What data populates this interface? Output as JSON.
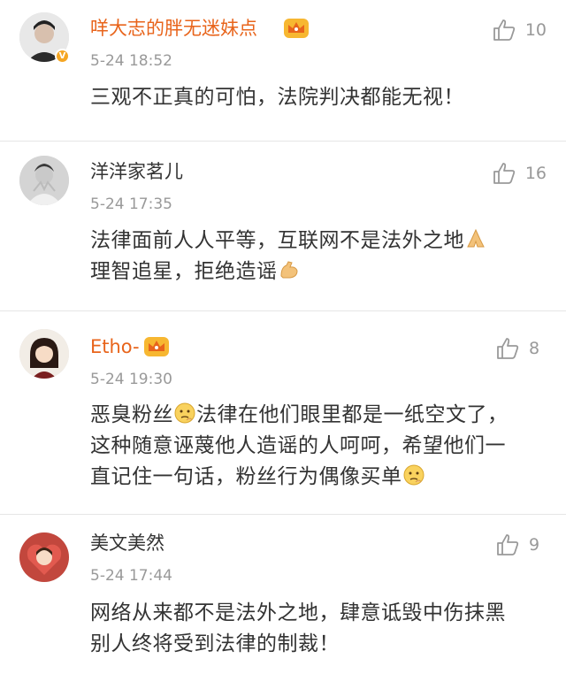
{
  "comments": [
    {
      "username": "咩大志的胖无迷妹点",
      "time": "5-24 18:52",
      "likes": "10",
      "lines": [
        "三观不正真的可怕，法院判决都能无视！"
      ]
    },
    {
      "username": "洋洋家茗儿",
      "time": "5-24 17:35",
      "likes": "16",
      "lines": [
        "法律面前人人平等，互联网不是法外之地",
        "理智追星，拒绝造谣"
      ]
    },
    {
      "username": "Etho-",
      "time": "5-24 19:30",
      "likes": "8",
      "lines": [
        "恶臭粉丝",
        "法律在他们眼里都是一纸空文了，",
        "这种随意诬蔑他人造谣的人呵呵，希望他们一",
        "直记住一句话，粉丝行为偶像买单"
      ]
    },
    {
      "username": "美文美然",
      "time": "5-24 17:44",
      "likes": "9",
      "lines": [
        "网络从来都不是法外之地，肆意诋毁中伤抹黑",
        "别人终将受到法律的制裁！"
      ]
    }
  ],
  "icons": {
    "like": "thumbs-up-icon",
    "vip": "crown-badge-icon",
    "verified": "verified-badge-icon",
    "emoji_pray": "pray-hands-emoji",
    "emoji_muscle": "flexed-biceps-emoji",
    "emoji_think": "thinking-face-emoji"
  },
  "colors": {
    "vip_name": "#e8641b",
    "meta_gray": "#999999",
    "divider": "#e6e6e6"
  }
}
